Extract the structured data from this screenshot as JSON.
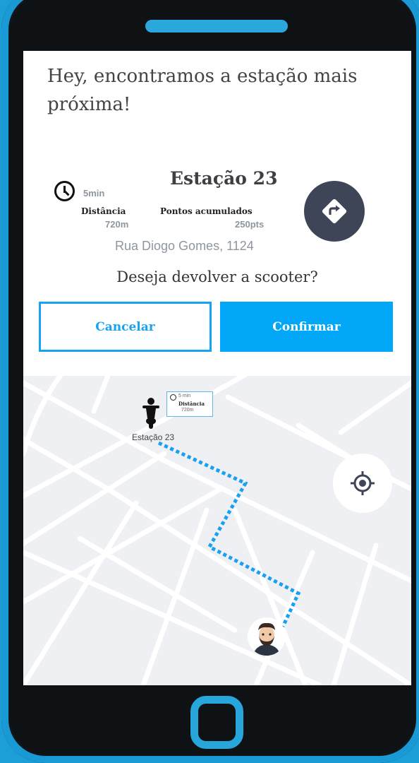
{
  "screen": {
    "headline": "Hey, encontramos a estação mais próxima!",
    "station": {
      "name": "Estação 23",
      "time": "5min",
      "distance_label": "Distância",
      "distance_value": "720m",
      "points_label": "Pontos acumulados",
      "points_value": "250pts",
      "address": "Rua Diogo Gomes, 1124"
    },
    "question": "Deseja devolver a scooter?",
    "buttons": {
      "cancel": "Cancelar",
      "confirm": "Confirmar"
    }
  },
  "map": {
    "station_label": "Estação 23",
    "mini_card": {
      "time": "5 min",
      "distance_label": "Distância",
      "distance_value": "720m"
    }
  },
  "icons": {
    "clock": "clock-icon",
    "directions": "directions-icon",
    "scooter": "scooter-icon",
    "locate": "locate-icon",
    "avatar": "user-avatar"
  },
  "colors": {
    "accent": "#02a7f7",
    "phone_frame": "#111418",
    "phone_trim": "#1c9ed6",
    "directions_button": "#3d4556",
    "route": "#1aa0f0",
    "map_background": "#eef0f4"
  }
}
